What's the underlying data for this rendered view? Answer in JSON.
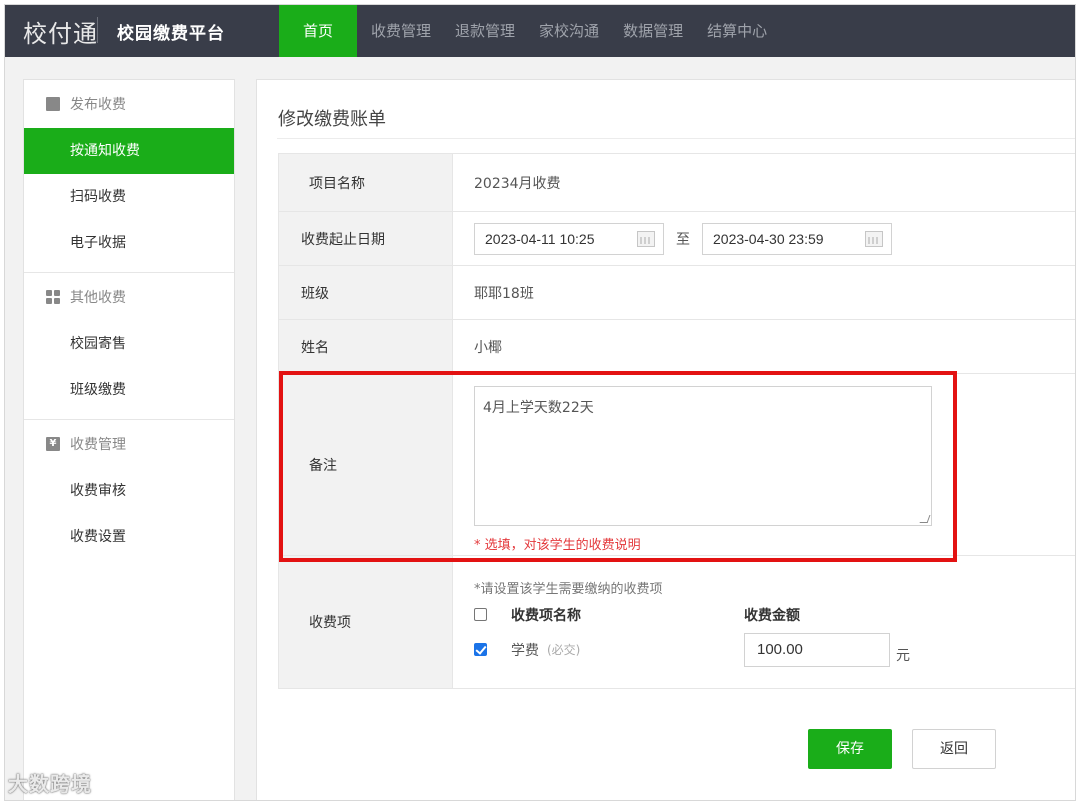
{
  "header": {
    "logo_text": "校付通",
    "platform": "校园缴费平台",
    "nav": [
      {
        "label": "首页",
        "active": true
      },
      {
        "label": "收费管理",
        "active": false
      },
      {
        "label": "退款管理",
        "active": false
      },
      {
        "label": "家校沟通",
        "active": false
      },
      {
        "label": "数据管理",
        "active": false
      },
      {
        "label": "结算中心",
        "active": false
      }
    ]
  },
  "sidebar": {
    "groups": [
      {
        "title": "发布收费",
        "icon": "edit-icon",
        "items": [
          "按通知收费",
          "扫码收费",
          "电子收据"
        ]
      },
      {
        "title": "其他收费",
        "icon": "grid-icon",
        "items": [
          "校园寄售",
          "班级缴费"
        ]
      },
      {
        "title": "收费管理",
        "icon": "yen-icon",
        "items": [
          "收费审核",
          "收费设置"
        ]
      }
    ],
    "active_item": "按通知收费"
  },
  "main": {
    "title": "修改缴费账单",
    "fields": {
      "project_label": "项目名称",
      "project_value": "20234月收费",
      "date_label": "收费起止日期",
      "start_date": "2023-04-11 10:25",
      "to_text": "至",
      "end_date": "2023-04-30 23:59",
      "class_label": "班级",
      "class_value": "耶耶18班",
      "name_label": "姓名",
      "name_value": "小椰",
      "remark_label": "备注",
      "remark_value": "4月上学天数22天",
      "remark_hint": "* 选填，对该学生的收费说明",
      "fee_label": "收费项",
      "fee_hint": "*请设置该学生需要缴纳的收费项",
      "fee_col_name": "收费项名称",
      "fee_col_amount": "收费金额",
      "fee_item_name": "学费",
      "fee_item_required": "(必交)",
      "fee_item_amount": "100.00",
      "fee_unit": "元"
    },
    "buttons": {
      "save": "保存",
      "back": "返回"
    }
  },
  "colors": {
    "accent": "#1aad19",
    "topbar": "#393d49",
    "highlight": "#e31212",
    "hint": "#e4393c"
  },
  "watermark": "大数跨境"
}
